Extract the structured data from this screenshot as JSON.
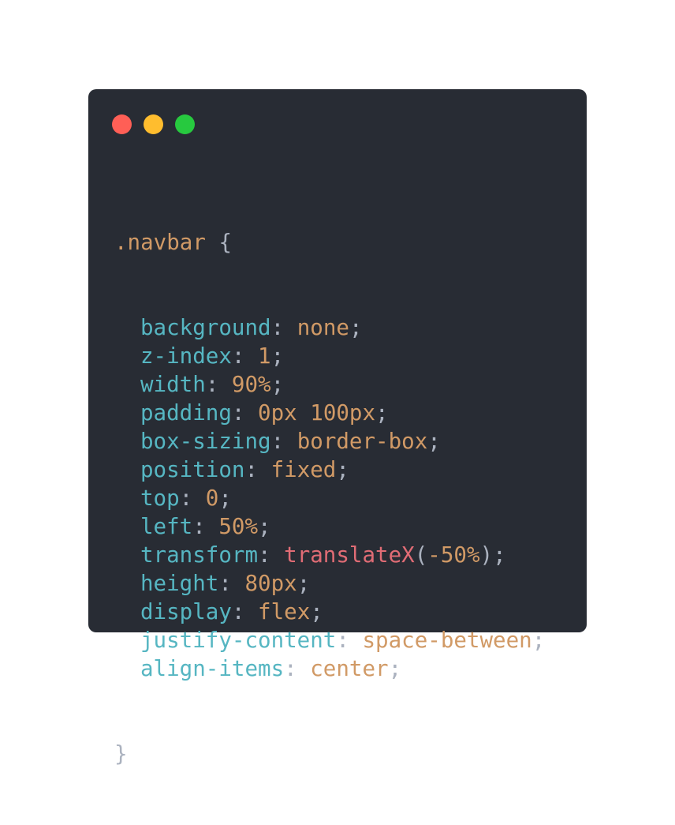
{
  "window": {
    "controls": [
      {
        "name": "close-dot",
        "color": "#ff5f56"
      },
      {
        "name": "minimize-dot",
        "color": "#ffbd2e"
      },
      {
        "name": "maximize-dot",
        "color": "#27c93f"
      }
    ]
  },
  "code": {
    "selector": ".navbar",
    "open_brace": " {",
    "close_brace": "}",
    "declarations": [
      {
        "prop": "background",
        "value": [
          {
            "t": "none",
            "k": "val"
          }
        ]
      },
      {
        "prop": "z-index",
        "value": [
          {
            "t": "1",
            "k": "val"
          }
        ]
      },
      {
        "prop": "width",
        "value": [
          {
            "t": "90%",
            "k": "val"
          }
        ]
      },
      {
        "prop": "padding",
        "value": [
          {
            "t": "0px 100px",
            "k": "val"
          }
        ]
      },
      {
        "prop": "box-sizing",
        "value": [
          {
            "t": "border-box",
            "k": "val"
          }
        ]
      },
      {
        "prop": "position",
        "value": [
          {
            "t": "fixed",
            "k": "val"
          }
        ]
      },
      {
        "prop": "top",
        "value": [
          {
            "t": "0",
            "k": "val"
          }
        ]
      },
      {
        "prop": "left",
        "value": [
          {
            "t": "50%",
            "k": "val"
          }
        ]
      },
      {
        "prop": "transform",
        "value": [
          {
            "t": "translateX",
            "k": "func"
          },
          {
            "t": "(",
            "k": "punct"
          },
          {
            "t": "-50%",
            "k": "val"
          },
          {
            "t": ")",
            "k": "punct"
          }
        ]
      },
      {
        "prop": "height",
        "value": [
          {
            "t": "80px",
            "k": "val"
          }
        ]
      },
      {
        "prop": "display",
        "value": [
          {
            "t": "flex",
            "k": "val"
          }
        ]
      },
      {
        "prop": "justify-content",
        "value": [
          {
            "t": "space-between",
            "k": "val"
          }
        ]
      },
      {
        "prop": "align-items",
        "value": [
          {
            "t": "center",
            "k": "val"
          }
        ]
      }
    ]
  },
  "colors": {
    "background": "#282c34",
    "selector": "#d19a66",
    "property": "#56b6c2",
    "value": "#d19a66",
    "function": "#e06c75",
    "punctuation": "#abb2bf"
  }
}
